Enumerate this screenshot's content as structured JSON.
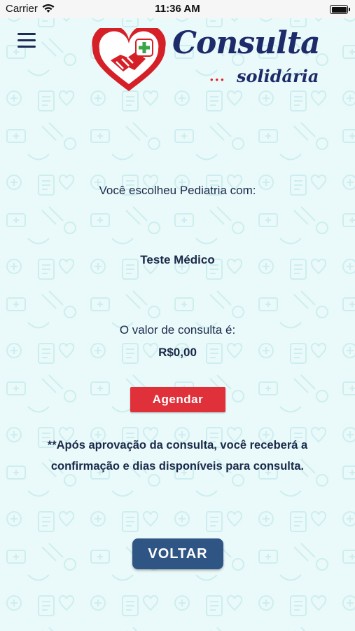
{
  "status_bar": {
    "carrier": "Carrier",
    "time": "11:36 AM"
  },
  "header": {
    "logo_line1": "Consulta",
    "logo_line2": "solidária",
    "logo_dots": "•••"
  },
  "main": {
    "intro": "Você escolheu Pediatria com:",
    "doctor": "Teste Médico",
    "price_label": "O valor de consulta é:",
    "price": "R$0,00",
    "schedule_button": "Agendar",
    "note": "**Após aprovação da consulta, você receberá a confirmação e dias disponíveis para consulta.",
    "back_button": "VOLTAR"
  },
  "colors": {
    "background": "#eaf9f9",
    "accent_red": "#e0303a",
    "navy": "#1d2b6b",
    "back_button": "#2f5585"
  }
}
